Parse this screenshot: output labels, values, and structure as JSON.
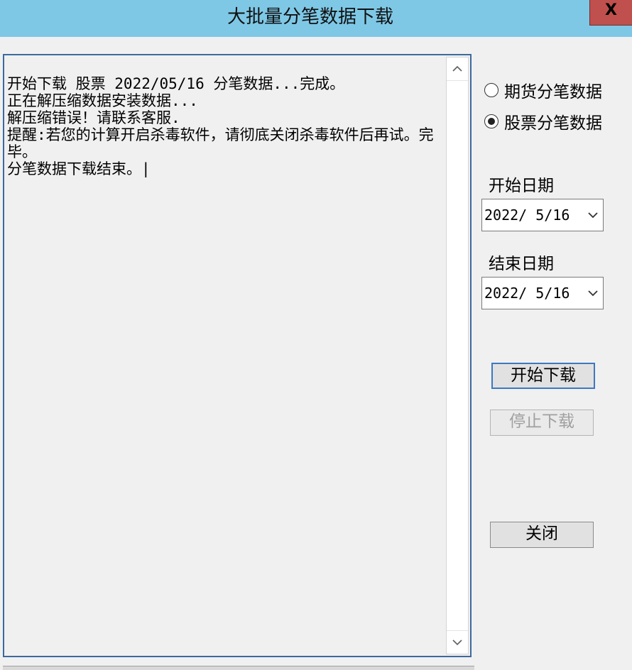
{
  "window": {
    "title": "大批量分笔数据下载",
    "close_label": "X"
  },
  "log": {
    "text": "开始下载 股票 2022/05/16 分笔数据...完成。\n正在解压缩数据安装数据...\n解压缩错误！请联系客服.\n提醒:若您的计算开启杀毒软件，请彻底关闭杀毒软件后再试。完毕。\n分笔数据下载结束。|"
  },
  "data_type": {
    "options": [
      {
        "label": "期货分笔数据",
        "selected": false
      },
      {
        "label": "股票分笔数据",
        "selected": true
      }
    ]
  },
  "start_date": {
    "label": "开始日期",
    "value": "2022/ 5/16"
  },
  "end_date": {
    "label": "结束日期",
    "value": "2022/ 5/16"
  },
  "buttons": {
    "start": "开始下载",
    "stop": "停止下载",
    "close": "关闭"
  }
}
